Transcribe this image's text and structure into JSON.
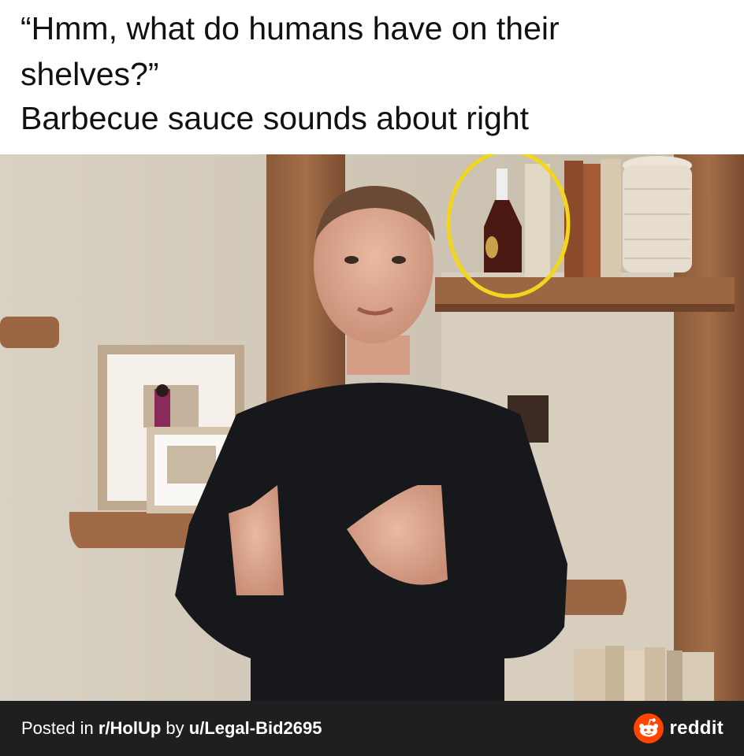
{
  "caption": {
    "line1": "“Hmm, what do humans have on their",
    "line2": "shelves?”",
    "line3": "Barbecue sauce sounds about right"
  },
  "footer": {
    "posted_prefix": "Posted in ",
    "subreddit": "r/HolUp",
    "by_text": " by ",
    "username": "u/Legal-Bid2695",
    "brand": "reddit",
    "brand_icon": "reddit-alien-icon",
    "brand_color": "#FF4500"
  },
  "colors": {
    "highlight_circle": "#F2D61B",
    "footer_bg": "#1f1f1f"
  }
}
